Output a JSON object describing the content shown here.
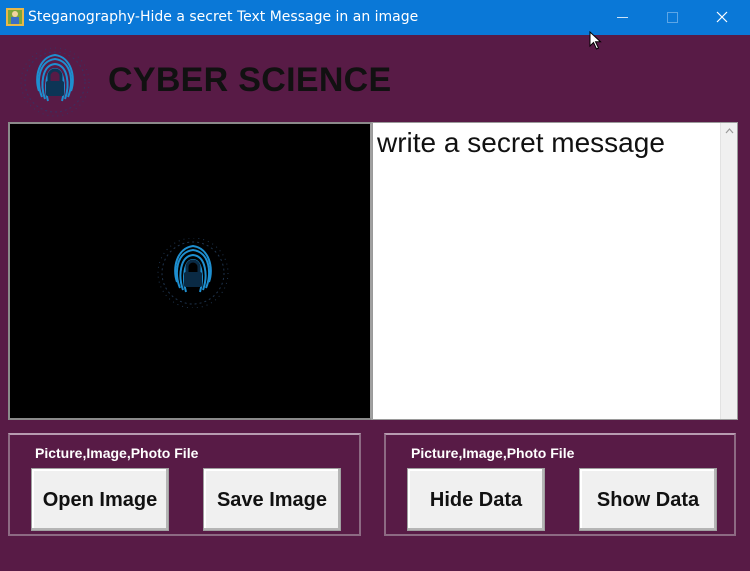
{
  "window": {
    "title": "Steganography-Hide a secret Text Message in an image",
    "controls": [
      "minimize",
      "maximize",
      "close"
    ]
  },
  "header": {
    "brand": "CYBER SCIENCE",
    "logo_icon": "fingerprint-lock-icon"
  },
  "image_panel": {
    "placeholder_icon": "fingerprint-lock-icon"
  },
  "message": {
    "text": "write a secret message"
  },
  "left_group": {
    "label": "Picture,Image,Photo File",
    "open_label": "Open Image",
    "save_label": "Save Image"
  },
  "right_group": {
    "label": "Picture,Image,Photo File",
    "hide_label": "Hide Data",
    "show_label": "Show Data"
  },
  "colors": {
    "titlebar": "#0a78d7",
    "background": "#581b46",
    "accent": "#1e8fd0"
  }
}
